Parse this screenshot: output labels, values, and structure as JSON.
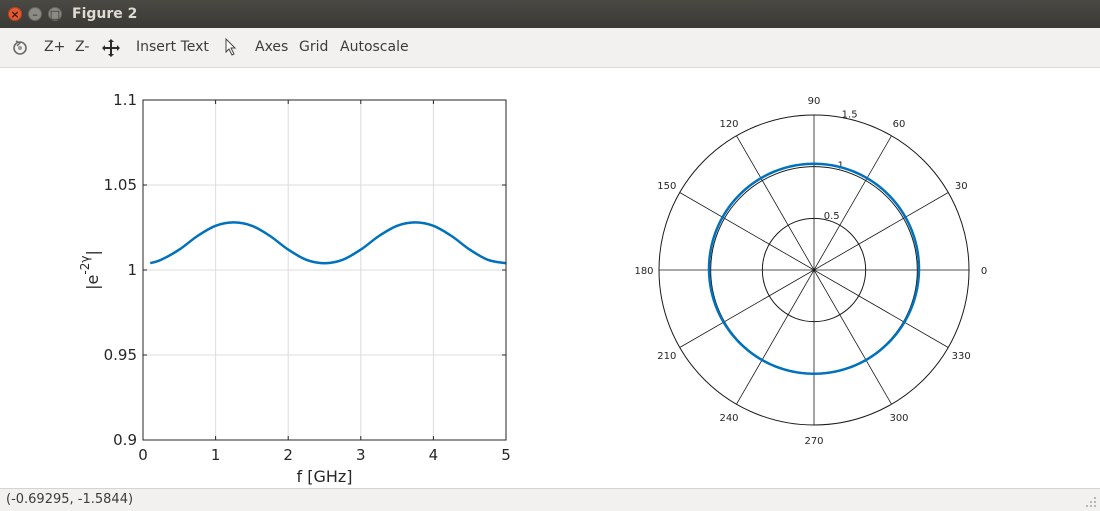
{
  "window": {
    "title": "Figure 2"
  },
  "toolbar": {
    "zoom_in": "Z+",
    "zoom_out": "Z-",
    "insert_text": "Insert Text",
    "axes": "Axes",
    "grid": "Grid",
    "autoscale": "Autoscale"
  },
  "status": {
    "coords": "(-0.69295, -1.5844)"
  },
  "colors": {
    "series": "#0072bd",
    "grid": "#dcdcdc",
    "axis": "#262626"
  },
  "chart_data": [
    {
      "type": "line",
      "xlabel": "f [GHz]",
      "ylabel": {
        "base": "|e",
        "sup": "-2γ",
        "tail": "|"
      },
      "xlim": [
        0,
        5
      ],
      "ylim": [
        0.9,
        1.1
      ],
      "xticks": [
        0,
        1,
        2,
        3,
        4,
        5
      ],
      "yticks": [
        0.9,
        0.95,
        1,
        1.05,
        1.1
      ],
      "ytick_labels": [
        "0.9",
        "0.95",
        "1",
        "1.05",
        "1.1"
      ],
      "grid": true,
      "series": [
        {
          "x": [
            0.1,
            0.25,
            0.5,
            0.75,
            1.0,
            1.25,
            1.5,
            1.75,
            2.0,
            2.25,
            2.5,
            2.75,
            3.0,
            3.25,
            3.5,
            3.75,
            4.0,
            4.25,
            4.5,
            4.75,
            5.0
          ],
          "values": [
            1.004,
            1.006,
            1.012,
            1.02,
            1.026,
            1.028,
            1.026,
            1.02,
            1.012,
            1.006,
            1.004,
            1.006,
            1.012,
            1.02,
            1.026,
            1.028,
            1.026,
            1.02,
            1.012,
            1.006,
            1.004
          ]
        }
      ]
    },
    {
      "type": "polar",
      "rlim": [
        0,
        1.5
      ],
      "rticks": [
        0.5,
        1,
        1.5
      ],
      "rtick_labels": [
        "0.5",
        "1",
        "1.5"
      ],
      "theta_ticks": [
        0,
        30,
        60,
        90,
        120,
        150,
        180,
        210,
        240,
        270,
        300,
        330
      ],
      "theta_labels": [
        "0",
        "30",
        "60",
        "90",
        "120",
        "150",
        "180",
        "210",
        "240",
        "270",
        "300",
        "330"
      ],
      "series": [
        {
          "r_min": 1.004,
          "r_max": 1.028,
          "shape": "near-unit circle"
        }
      ]
    }
  ]
}
